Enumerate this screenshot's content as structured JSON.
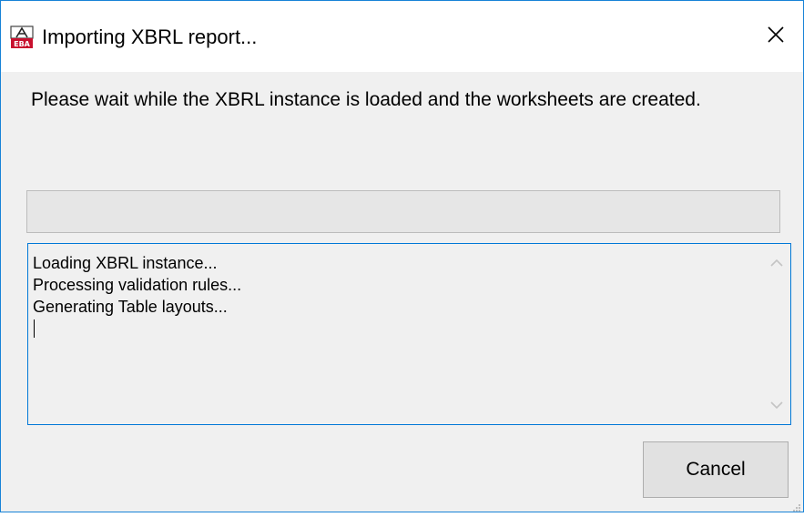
{
  "window": {
    "title": "Importing XBRL report...",
    "icon": "eba-app-icon",
    "close_icon": "close-icon"
  },
  "message": "Please wait while the XBRL instance is loaded and the worksheets are created.",
  "progress": {
    "value": 0
  },
  "log": {
    "lines": [
      "Loading XBRL instance...",
      "Processing validation rules...",
      "Generating Table layouts..."
    ]
  },
  "buttons": {
    "cancel_label": "Cancel"
  },
  "colors": {
    "window_border": "#1883d7",
    "dialog_bg": "#f0f0f0",
    "focus_border": "#0078d7",
    "icon_red": "#c8102e"
  }
}
